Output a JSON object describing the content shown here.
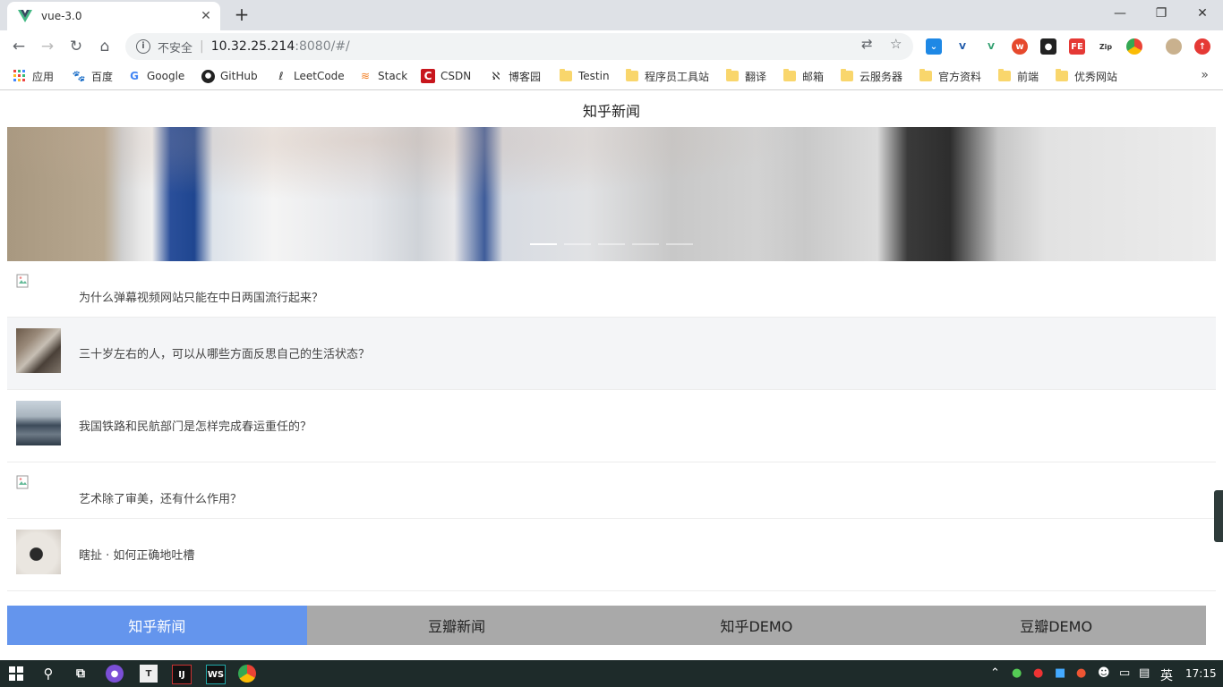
{
  "browser": {
    "tab_title": "vue-3.0",
    "new_tab": "+",
    "window_controls": {
      "minimize": "—",
      "maximize": "❐",
      "close": "✕"
    },
    "security_label": "不安全",
    "separator": "|",
    "url_host": "10.32.25.214",
    "url_path": ":8080/#/"
  },
  "bookmarks": [
    {
      "label": "应用",
      "icon": "apps-icon"
    },
    {
      "label": "百度",
      "icon": "baidu-icon"
    },
    {
      "label": "Google",
      "icon": "google-icon"
    },
    {
      "label": "GitHub",
      "icon": "github-icon"
    },
    {
      "label": "LeetCode",
      "icon": "leetcode-icon"
    },
    {
      "label": "Stack",
      "icon": "stackoverflow-icon"
    },
    {
      "label": "CSDN",
      "icon": "csdn-icon"
    },
    {
      "label": "博客园",
      "icon": "cnblogs-icon"
    },
    {
      "label": "Testin",
      "icon": "folder-icon"
    },
    {
      "label": "程序员工具站",
      "icon": "folder-icon"
    },
    {
      "label": "翻译",
      "icon": "folder-icon"
    },
    {
      "label": "邮箱",
      "icon": "folder-icon"
    },
    {
      "label": "云服务器",
      "icon": "folder-icon"
    },
    {
      "label": "官方资料",
      "icon": "folder-icon"
    },
    {
      "label": "前端",
      "icon": "folder-icon"
    },
    {
      "label": "优秀网站",
      "icon": "folder-icon"
    }
  ],
  "bookmarks_more": "»",
  "page": {
    "header_title": "知乎新闻",
    "carousel_slides": 5,
    "carousel_active_index": 0,
    "news": [
      {
        "title": "为什么弹幕视频网站只能在中日两国流行起来？",
        "image": "broken"
      },
      {
        "title": "三十岁左右的人，可以从哪些方面反思自己的生活状态？",
        "image": "photo"
      },
      {
        "title": "我国铁路和民航部门是怎样完成春运重任的？",
        "image": "photo"
      },
      {
        "title": "艺术除了审美，还有什么作用？",
        "image": "broken"
      },
      {
        "title": "瞎扯 · 如何正确地吐槽",
        "image": "photo"
      }
    ],
    "tabs": [
      "知乎新闻",
      "豆瓣新闻",
      "知乎DEMO",
      "豆瓣DEMO"
    ],
    "active_tab": 0
  },
  "taskbar": {
    "ime": "英",
    "clock": "17:15"
  },
  "colors": {
    "active_tab": "#6495ed",
    "inactive_tab": "#a9a9a9"
  }
}
